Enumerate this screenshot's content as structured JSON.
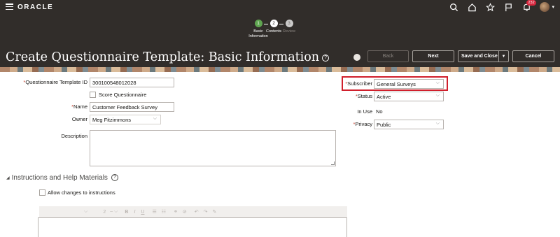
{
  "topbar": {
    "logo": "ORACLE",
    "notification_count": "232",
    "icons": [
      "menu-icon",
      "search-icon",
      "home-icon",
      "star-icon",
      "flag-icon",
      "bell-icon",
      "avatar"
    ]
  },
  "train": {
    "stops": [
      {
        "num": "1",
        "label": "Basic Information",
        "state": "active"
      },
      {
        "num": "2",
        "label": "Contents",
        "state": "next"
      },
      {
        "num": "3",
        "label": "Review",
        "state": "future"
      }
    ]
  },
  "header": {
    "title": "Create Questionnaire Template: Basic Information",
    "back_label": "Back",
    "next_label": "Next",
    "save_close_label": "Save and Close",
    "cancel_label": "Cancel"
  },
  "form": {
    "template_id_label": "Questionnaire Template ID",
    "template_id_value": "300100548012028",
    "score_label": "Score Questionnaire",
    "name_label": "Name",
    "name_value": "Customer Feedback Survey",
    "owner_label": "Owner",
    "owner_value": "Meg Fitzimmons",
    "description_label": "Description",
    "subscriber_label": "Subscriber",
    "subscriber_value": "General Surveys",
    "status_label": "Status",
    "status_value": "Active",
    "in_use_label": "In Use",
    "in_use_value": "No",
    "privacy_label": "Privacy",
    "privacy_value": "Public"
  },
  "instructions": {
    "title": "Instructions and Help Materials",
    "allow_changes_label": "Allow changes to instructions",
    "font_size": "2"
  },
  "colors": {
    "header_bg": "#312d2a",
    "active_step": "#5fa550",
    "highlight": "#d01f2c",
    "required": "#c74634"
  }
}
